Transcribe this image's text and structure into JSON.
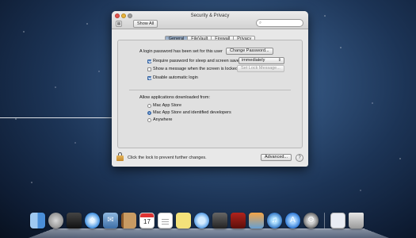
{
  "window": {
    "title": "Security & Privacy",
    "show_all_label": "Show All",
    "search_placeholder": ""
  },
  "tabs": [
    {
      "label": "General",
      "active": true
    },
    {
      "label": "FileVault",
      "active": false
    },
    {
      "label": "Firewall",
      "active": false
    },
    {
      "label": "Privacy",
      "active": false
    }
  ],
  "general": {
    "login_password_text": "A login password has been set for this user",
    "change_password_label": "Change Password...",
    "require_password_label": "Require password for sleep and screen saver",
    "require_password_checked": true,
    "require_password_delay": "immediately",
    "show_message_label": "Show a message when the screen is locked",
    "show_message_checked": false,
    "set_lock_message_label": "Set Lock Message...",
    "disable_auto_login_label": "Disable automatic login",
    "disable_auto_login_checked": true,
    "allow_apps_title": "Allow applications downloaded from:",
    "allow_options": [
      {
        "label": "Mac App Store",
        "selected": false
      },
      {
        "label": "Mac App Store and identified developers",
        "selected": true
      },
      {
        "label": "Anywhere",
        "selected": false
      }
    ]
  },
  "footer": {
    "lock_text": "Click the lock to prevent further changes.",
    "advanced_label": "Advanced...",
    "help_label": "?"
  },
  "dock": {
    "calendar_day": "17",
    "items": [
      "finder-icon",
      "launchpad-icon",
      "mission-control-icon",
      "safari-icon",
      "mail-icon",
      "contacts-icon",
      "calendar-icon",
      "reminders-icon",
      "notes-icon",
      "messages-icon",
      "facetime-icon",
      "photo-booth-icon",
      "iphoto-icon",
      "itunes-icon",
      "app-store-icon",
      "system-preferences-icon",
      "documents-icon",
      "trash-icon"
    ]
  }
}
